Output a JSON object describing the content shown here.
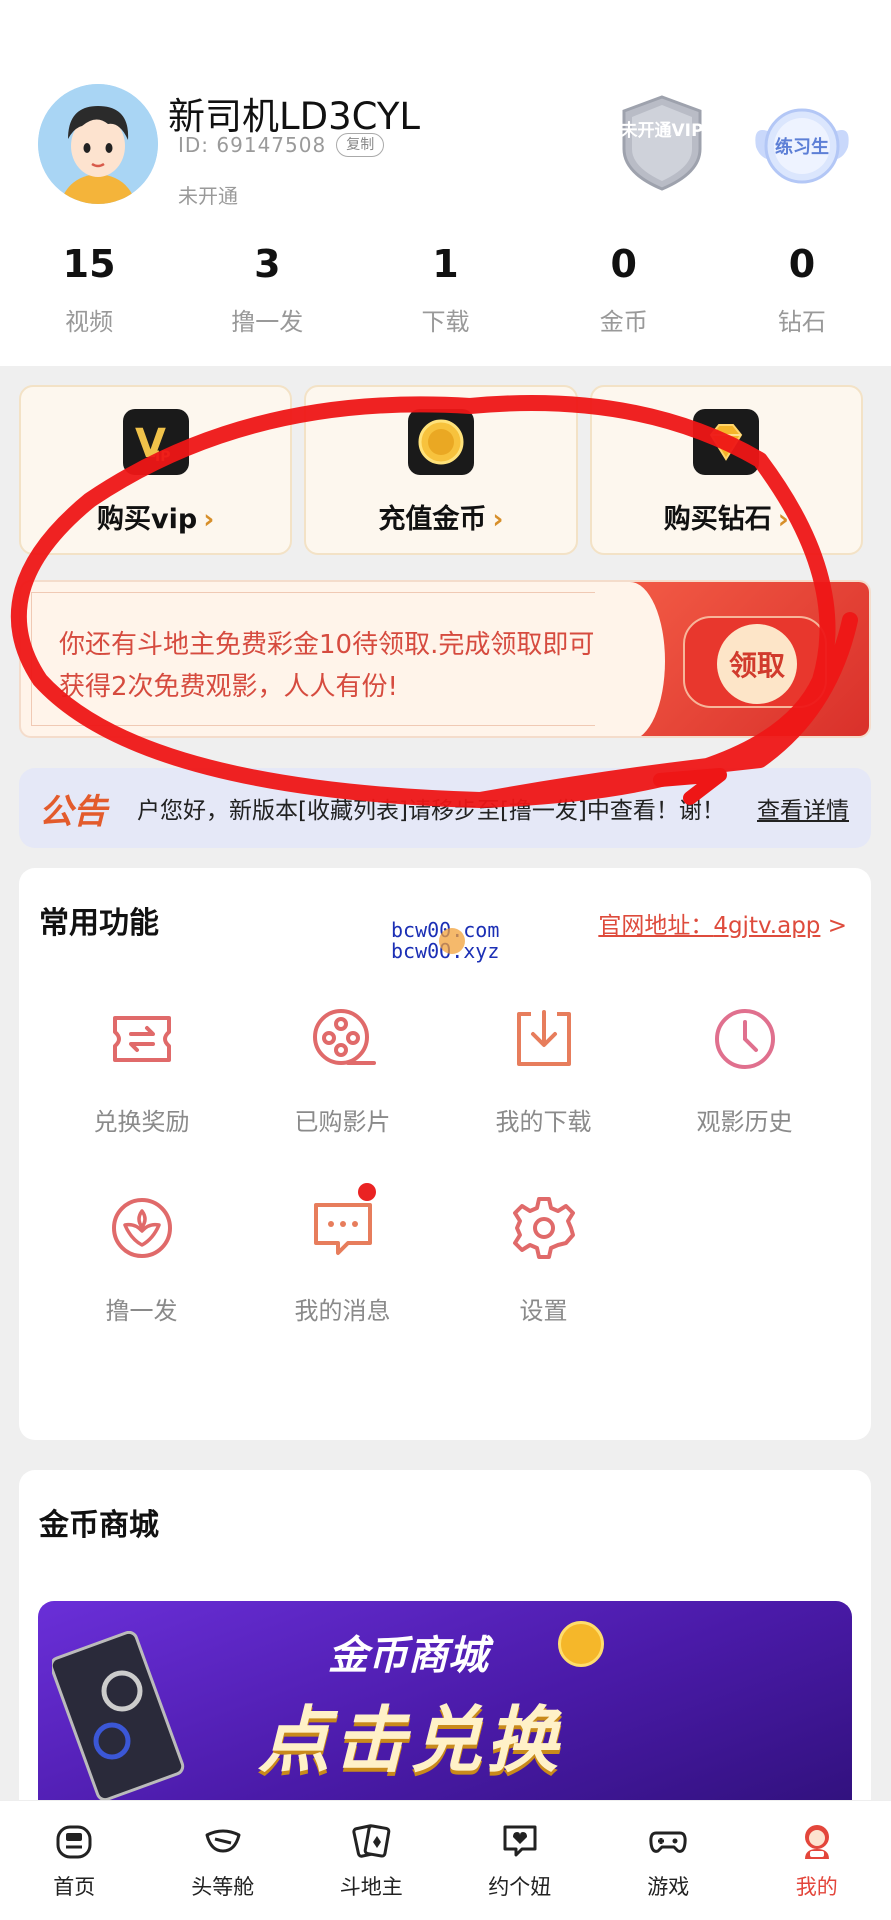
{
  "profile": {
    "username": "新司机LD3CYL",
    "id_label": "ID: 69147508",
    "copy_label": "复制",
    "status": "未开通",
    "vip_badge": "未开通VIP",
    "rank_badge": "练习生"
  },
  "stats": [
    {
      "value": "15",
      "label": "视频"
    },
    {
      "value": "3",
      "label": "撸一发"
    },
    {
      "value": "1",
      "label": "下载"
    },
    {
      "value": "0",
      "label": "金币"
    },
    {
      "value": "0",
      "label": "钻石"
    }
  ],
  "cards": [
    {
      "label": "购买vip",
      "arrow": "›"
    },
    {
      "label": "充值金币",
      "arrow": "›"
    },
    {
      "label": "购买钻石",
      "arrow": "›"
    }
  ],
  "promo": {
    "text": "你还有斗地主免费彩金10待领取.完成领取即可获得2次免费观影，人人有份!",
    "button": "领取"
  },
  "notice": {
    "tag": "公告",
    "text": "户您好，新版本[收藏列表]请移步至[撸一发]中查看！谢！",
    "more": "查看详情"
  },
  "functions": {
    "title": "常用功能",
    "site_prefix": "官网地址：",
    "site_url": "4gjtv.app",
    "site_arrow": ">",
    "watermark_line1": "bcw00.com",
    "watermark_line2": "bcw0O.xyz",
    "items": [
      {
        "label": "兑换奖励",
        "icon": "ticket-exchange-icon"
      },
      {
        "label": "已购影片",
        "icon": "film-reel-icon"
      },
      {
        "label": "我的下载",
        "icon": "download-icon"
      },
      {
        "label": "观影历史",
        "icon": "clock-icon"
      },
      {
        "label": "撸一发",
        "icon": "emblem-icon"
      },
      {
        "label": "我的消息",
        "icon": "message-icon"
      },
      {
        "label": "设置",
        "icon": "gear-icon"
      }
    ]
  },
  "store": {
    "title": "金币商城",
    "banner_title": "金币商城",
    "banner_big": "点击兑换"
  },
  "nav": [
    {
      "label": "首页",
      "icon": "home-icon"
    },
    {
      "label": "头等舱",
      "icon": "mask-icon"
    },
    {
      "label": "斗地主",
      "icon": "cards-icon"
    },
    {
      "label": "约个妞",
      "icon": "heart-chat-icon"
    },
    {
      "label": "游戏",
      "icon": "gamepad-icon"
    },
    {
      "label": "我的",
      "icon": "profile-icon",
      "active": true
    }
  ],
  "colors": {
    "accent": "#e3463b",
    "promo_red": "#d64b3f",
    "card_bg": "#fdf7ee",
    "notice_bg": "#e5e8f7"
  }
}
